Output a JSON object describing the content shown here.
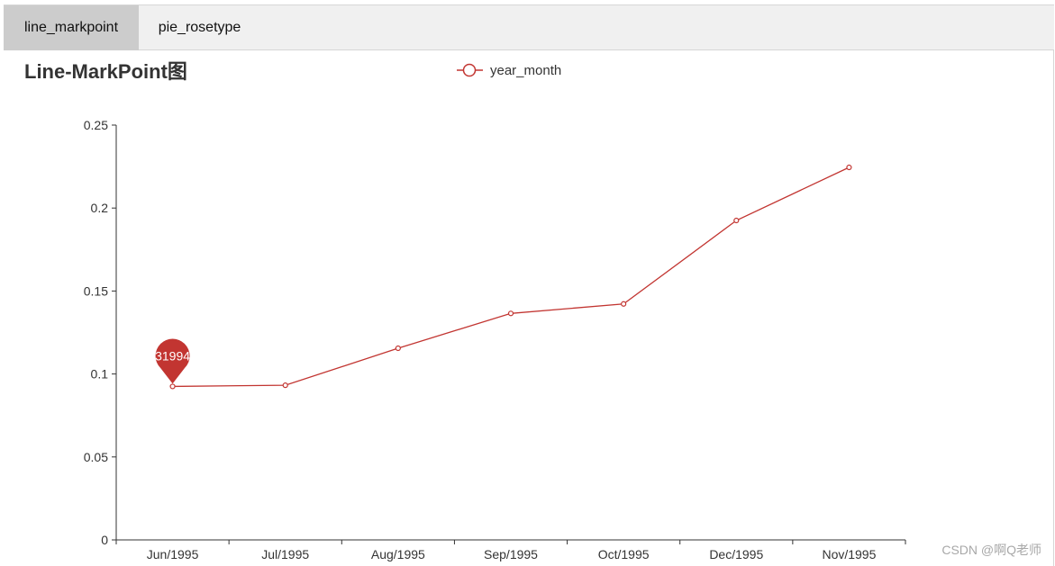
{
  "tabs": [
    {
      "label": "line_markpoint",
      "active": true
    },
    {
      "label": "pie_rosetype",
      "active": false
    }
  ],
  "chart_data": {
    "type": "line",
    "title": "Line-MarkPoint图",
    "legend": {
      "entries": [
        "year_month"
      ],
      "placement": "top-center"
    },
    "categories": [
      "Jun/1995",
      "Jul/1995",
      "Aug/1995",
      "Sep/1995",
      "Oct/1995",
      "Dec/1995",
      "Nov/1995"
    ],
    "series": [
      {
        "name": "year_month",
        "values": [
          0.0925,
          0.0932,
          0.1155,
          0.1365,
          0.1422,
          0.1925,
          0.2245
        ]
      }
    ],
    "ylim": [
      0,
      0.25
    ],
    "yticks": [
      "0",
      "0.05",
      "0.1",
      "0.15",
      "0.2",
      "0.25"
    ],
    "grid": false,
    "color": "#c23531",
    "markpoint": {
      "index": 0,
      "label": "31994"
    }
  },
  "watermark": "CSDN @啊Q老师"
}
